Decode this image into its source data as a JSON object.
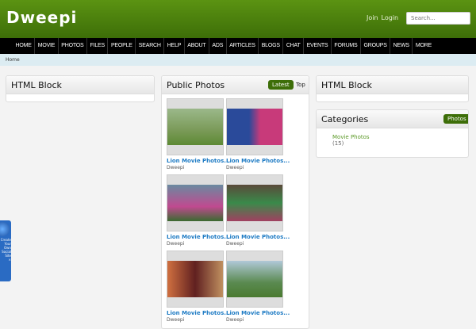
{
  "header": {
    "logo": "Dweepi",
    "join": "Join",
    "login": "Login",
    "search_placeholder": "Search..."
  },
  "nav": [
    "HOME",
    "MOVIE",
    "PHOTOS",
    "FILES",
    "PEOPLE",
    "SEARCH",
    "HELP",
    "ABOUT",
    "ADS",
    "ARTICLES",
    "BLOGS",
    "CHAT",
    "EVENTS",
    "FORUMS",
    "GROUPS",
    "NEWS",
    "MORE"
  ],
  "breadcrumb": "Home",
  "left": {
    "title": "HTML Block"
  },
  "middle": {
    "title": "Public Photos",
    "tab_latest": "Latest",
    "tab_top": "Top",
    "photos": [
      {
        "title": "Lion Movie Photos...",
        "author": "Dweepi"
      },
      {
        "title": "Lion Movie Photos...",
        "author": "Dweepi"
      },
      {
        "title": "Lion Movie Photos...",
        "author": "Dweepi"
      },
      {
        "title": "Lion Movie Photos...",
        "author": "Dweepi"
      },
      {
        "title": "Lion Movie Photos...",
        "author": "Dweepi"
      },
      {
        "title": "Lion Movie Photos...",
        "author": "Dweepi"
      }
    ]
  },
  "right": {
    "html_title": "HTML Block",
    "cat_title": "Categories",
    "cat_button": "Photos",
    "category": "Movie Photos",
    "count": "(15)"
  },
  "badge": {
    "text": "Create Your Own Social Site",
    "close": "×"
  }
}
